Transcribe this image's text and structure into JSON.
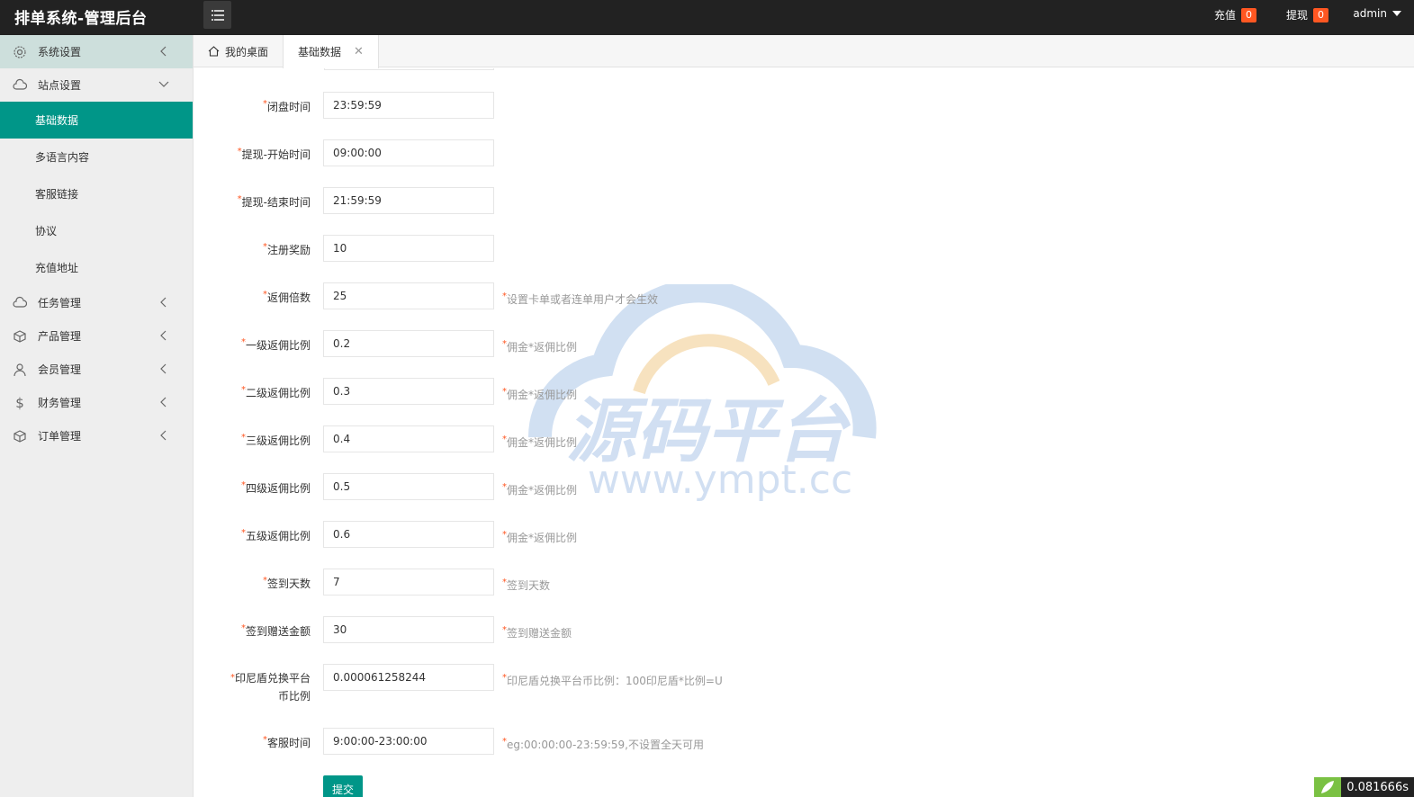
{
  "app": {
    "title": "排单系统-管理后台"
  },
  "header": {
    "recharge_label": "充值",
    "recharge_count": "0",
    "withdraw_label": "提现",
    "withdraw_count": "0",
    "user": "admin",
    "badge_color": "#ff5722",
    "bg_color": "#222222"
  },
  "sidebar": {
    "groups": [
      {
        "label": "系统设置",
        "icon": "gear-icon",
        "expanded": false
      },
      {
        "label": "站点设置",
        "icon": "cloud-icon",
        "expanded": true,
        "items": [
          "基础数据",
          "多语言内容",
          "客服链接",
          "协议",
          "充值地址"
        ],
        "active": "基础数据"
      },
      {
        "label": "任务管理",
        "icon": "cloud-icon",
        "expanded": false
      },
      {
        "label": "产品管理",
        "icon": "box-icon",
        "expanded": false
      },
      {
        "label": "会员管理",
        "icon": "user-icon",
        "expanded": false
      },
      {
        "label": "财务管理",
        "icon": "dollar-icon",
        "expanded": false
      },
      {
        "label": "订单管理",
        "icon": "box-icon",
        "expanded": false
      }
    ],
    "active_color": "#009688"
  },
  "tabs": [
    {
      "label": "我的桌面",
      "icon": "home-icon"
    },
    {
      "label": "基础数据",
      "active": true
    }
  ],
  "form": {
    "fields": [
      {
        "label": "闭盘时间",
        "value": "23:59:59",
        "hint": ""
      },
      {
        "label": "提现-开始时间",
        "value": "09:00:00",
        "hint": ""
      },
      {
        "label": "提现-结束时间",
        "value": "21:59:59",
        "hint": ""
      },
      {
        "label": "注册奖励",
        "value": "10",
        "hint": ""
      },
      {
        "label": "返佣倍数",
        "value": "25",
        "hint": "设置卡单或者连单用户才会生效"
      },
      {
        "label": "一级返佣比例",
        "value": "0.2",
        "hint": "佣金*返佣比例"
      },
      {
        "label": "二级返佣比例",
        "value": "0.3",
        "hint": "佣金*返佣比例"
      },
      {
        "label": "三级返佣比例",
        "value": "0.4",
        "hint": "佣金*返佣比例"
      },
      {
        "label": "四级返佣比例",
        "value": "0.5",
        "hint": "佣金*返佣比例"
      },
      {
        "label": "五级返佣比例",
        "value": "0.6",
        "hint": "佣金*返佣比例"
      },
      {
        "label": "签到天数",
        "value": "7",
        "hint": "签到天数"
      },
      {
        "label": "签到赠送金额",
        "value": "30",
        "hint": "签到赠送金额"
      },
      {
        "label": "印尼盾兑换平台币比例",
        "value": "0.000061258244",
        "hint": "印尼盾兑换平台币比例：100印尼盾*比例=U"
      },
      {
        "label": "客服时间",
        "value": "9:00:00-23:00:00",
        "hint": "eg:00:00:00-23:59:59,不设置全天可用"
      }
    ],
    "submit_label": "提交"
  },
  "watermark": {
    "title": "源码平台",
    "url": "www.ympt.cc"
  },
  "timer": "0.081666s"
}
